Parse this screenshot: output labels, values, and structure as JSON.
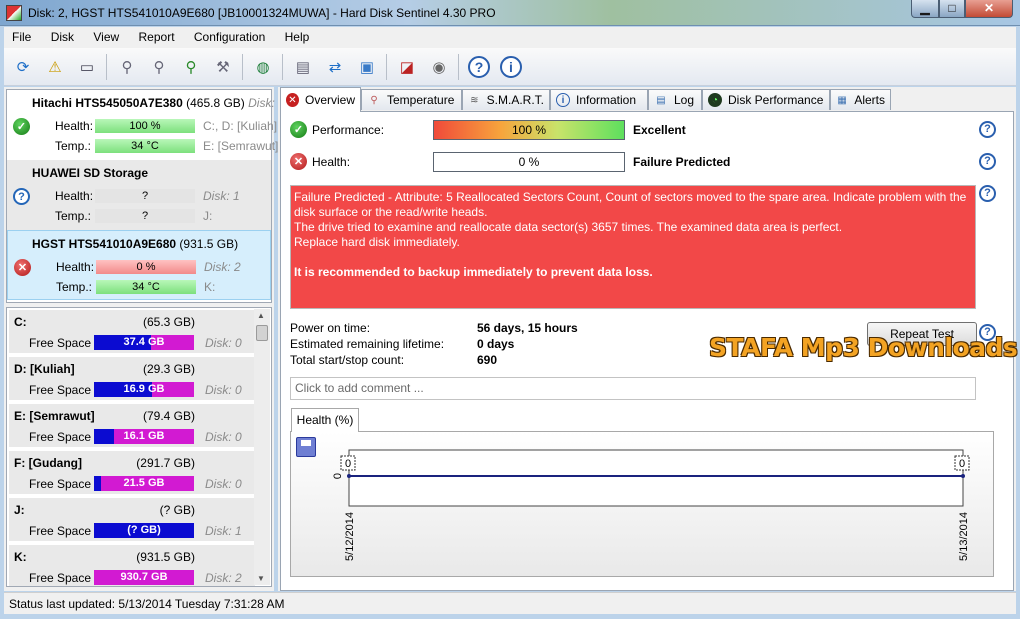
{
  "window": {
    "title": "Disk: 2, HGST HTS541010A9E680 [JB10001324MUWA]  -  Hard Disk Sentinel 4.30 PRO",
    "min": "▁",
    "max": "□",
    "close": "✕"
  },
  "menu": [
    "File",
    "Disk",
    "View",
    "Report",
    "Configuration",
    "Help"
  ],
  "toolbar_icons": [
    "refresh-icon",
    "warning-icon",
    "disk-info-icon",
    "test-disk-icon",
    "test-disk2-icon",
    "test-disk3-icon",
    "wrench-icon",
    "globe-icon",
    "report-icon",
    "transfer-icon",
    "network-icon",
    "benchmark-icon",
    "speaker-icon",
    "help-icon",
    "info-icon"
  ],
  "disks": [
    {
      "name": "Hitachi HTS545050A7E380",
      "size": "(465.8 GB)",
      "disk": "Disk:",
      "health_label": "Health:",
      "health": "100 %",
      "health_extra": "C:, D: [Kuliah]",
      "temp_label": "Temp.:",
      "temp": "34 °C",
      "temp_extra": "E: [Semrawut]",
      "status": "ok"
    },
    {
      "name": "HUAWEI  SD Storage",
      "size": "",
      "disk": "",
      "health_label": "Health:",
      "health": "?",
      "health_extra": "Disk: 1",
      "temp_label": "Temp.:",
      "temp": "?",
      "temp_extra": "J:",
      "status": "unknown"
    },
    {
      "name": "HGST HTS541010A9E680",
      "size": "(931.5 GB)",
      "disk": "",
      "health_label": "Health:",
      "health": "0 %",
      "health_extra": "Disk: 2",
      "temp_label": "Temp.:",
      "temp": "34 °C",
      "temp_extra": "K:",
      "status": "bad"
    }
  ],
  "volumes": [
    {
      "name": "C:",
      "size": "(65.3 GB)",
      "free_label": "Free Space",
      "free": "37.4 GB",
      "disk": "Disk: 0",
      "bar_color": "#0b0bd1",
      "fill_color": "#d21ad2",
      "free_fraction": 0.57
    },
    {
      "name": "D: [Kuliah]",
      "size": "(29.3 GB)",
      "free_label": "Free Space",
      "free": "16.9 GB",
      "disk": "Disk: 0",
      "bar_color": "#0b0bd1",
      "fill_color": "#d21ad2",
      "free_fraction": 0.58
    },
    {
      "name": "E: [Semrawut]",
      "size": "(79.4 GB)",
      "free_label": "Free Space",
      "free": "16.1 GB",
      "disk": "Disk: 0",
      "bar_color": "#0b0bd1",
      "fill_color": "#d21ad2",
      "free_fraction": 0.2
    },
    {
      "name": "F: [Gudang]",
      "size": "(291.7 GB)",
      "free_label": "Free Space",
      "free": "21.5 GB",
      "disk": "Disk: 0",
      "bar_color": "#0b0bd1",
      "fill_color": "#d21ad2",
      "free_fraction": 0.07
    },
    {
      "name": "J:",
      "size": "(? GB)",
      "free_label": "Free Space",
      "free": "(? GB)",
      "disk": "Disk: 1",
      "bar_color": "#0b0bd1",
      "fill_color": "#0b0bd1",
      "free_fraction": 0
    },
    {
      "name": "K:",
      "size": "(931.5 GB)",
      "free_label": "Free Space",
      "free": "930.7 GB",
      "disk": "Disk: 2",
      "bar_color": "#0b0bd1",
      "fill_color": "#d21ad2",
      "free_fraction": 1.0
    }
  ],
  "tabs": [
    {
      "label": "Overview",
      "icon": "error-icon"
    },
    {
      "label": "Temperature",
      "icon": "thermometer-icon"
    },
    {
      "label": "S.M.A.R.T.",
      "icon": "smart-icon"
    },
    {
      "label": "Information",
      "icon": "info-icon"
    },
    {
      "label": "Log",
      "icon": "log-icon"
    },
    {
      "label": "Disk Performance",
      "icon": "gauge-icon"
    },
    {
      "label": "Alerts",
      "icon": "alerts-icon"
    }
  ],
  "overview": {
    "performance_label": "Performance:",
    "performance_value": "100 %",
    "performance_rating": "Excellent",
    "health_label": "Health:",
    "health_value": "0 %",
    "health_rating": "Failure Predicted",
    "alert_lines": [
      "Failure Predicted - Attribute: 5 Reallocated Sectors Count, Count of sectors moved to the spare area. Indicate problem with the disk surface or the read/write heads.",
      "The drive tried to examine and reallocate data sector(s) 3657 times. The examined data area is perfect.",
      "Replace hard disk immediately."
    ],
    "alert_bold": "It is recommended to backup immediately to prevent data loss.",
    "power_on_label": "Power on time:",
    "power_on_value": "56 days, 15 hours",
    "lifetime_label": "Estimated remaining lifetime:",
    "lifetime_value": "0 days",
    "startstop_label": "Total start/stop count:",
    "startstop_value": "690",
    "repeat_button": "Repeat Test",
    "comment_placeholder": "Click to add comment ..."
  },
  "chart_tab": "Health (%)",
  "chart_data": {
    "type": "line",
    "x": [
      "5/12/2014",
      "5/13/2014"
    ],
    "series": [
      {
        "values": [
          0,
          0
        ]
      }
    ],
    "data_labels": [
      "0",
      "0"
    ],
    "ytick": "0",
    "line_color": "#1a237e"
  },
  "status": "Status last updated: 5/13/2014 Tuesday 7:31:28 AM",
  "watermark": "STAFA Mp3 Downloads"
}
